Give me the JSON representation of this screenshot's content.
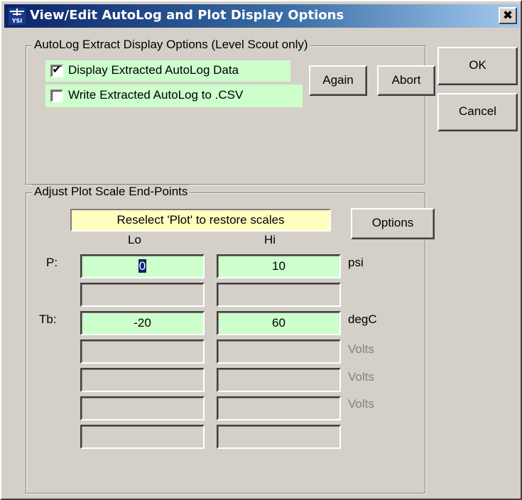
{
  "window": {
    "title": "View/Edit AutoLog and Plot Display Options",
    "close_glyph": "✖",
    "icon": "ysi-app-icon"
  },
  "autolog_group": {
    "label": "AutoLog Extract Display Options (Level Scout only)",
    "display_extracted": {
      "label": "Display Extracted AutoLog Data",
      "checked": true
    },
    "write_csv": {
      "label": "Write Extracted AutoLog to .CSV",
      "checked": false
    },
    "again_label": "Again",
    "abort_label": "Abort"
  },
  "side_buttons": {
    "ok_label": "OK",
    "cancel_label": "Cancel"
  },
  "plot_group": {
    "label": "Adjust Plot Scale End-Points",
    "notice": "Reselect 'Plot' to restore scales",
    "options_label": "Options",
    "lo_header": "Lo",
    "hi_header": "Hi",
    "rows": [
      {
        "label": "P:",
        "lo": "0",
        "hi": "10",
        "unit": "psi",
        "active": true,
        "lo_selected": true
      },
      {
        "label": "",
        "lo": "",
        "hi": "",
        "unit": "",
        "active": false
      },
      {
        "label": "Tb:",
        "lo": "-20",
        "hi": "60",
        "unit": "degC",
        "active": true
      },
      {
        "label": "",
        "lo": "",
        "hi": "",
        "unit": "Volts",
        "active": false
      },
      {
        "label": "",
        "lo": "",
        "hi": "",
        "unit": "Volts",
        "active": false
      },
      {
        "label": "",
        "lo": "",
        "hi": "",
        "unit": "Volts",
        "active": false
      },
      {
        "label": "",
        "lo": "",
        "hi": "",
        "unit": "",
        "active": false
      }
    ]
  },
  "colors": {
    "title_active_start": "#0a246a",
    "title_active_end": "#a6caf0",
    "field_active": "#ccffcc",
    "notice_bg": "#ffffc0",
    "face": "#d4d0c8"
  }
}
